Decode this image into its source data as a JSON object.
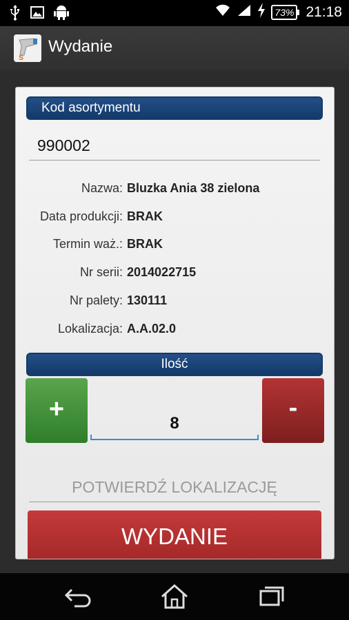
{
  "status_bar": {
    "battery": "73%",
    "time": "21:18",
    "icons": [
      "usb-icon",
      "image-icon",
      "android-icon",
      "wifi-icon",
      "signal-icon",
      "charging-icon",
      "battery-icon"
    ]
  },
  "action_bar": {
    "title": "Wydanie",
    "icon": "barcode-scanner-app-icon"
  },
  "form": {
    "kod_header": "Kod asortymentu",
    "kod_value": "990002",
    "details": [
      {
        "label": "Nazwa:",
        "value": "Bluzka Ania 38 zielona"
      },
      {
        "label": "Data produkcji:",
        "value": "BRAK"
      },
      {
        "label": "Termin waż.:",
        "value": "BRAK"
      },
      {
        "label": "Nr serii:",
        "value": "2014022715"
      },
      {
        "label": "Nr palety:",
        "value": "130111"
      },
      {
        "label": "Lokalizacja:",
        "value": "A.A.02.0"
      }
    ],
    "ilosc_header": "Ilość",
    "plus_label": "+",
    "minus_label": "-",
    "quantity": "8",
    "confirm_placeholder": "POTWIERDŹ LOKALIZACJĘ",
    "submit_label": "WYDANIE"
  },
  "colors": {
    "header_blue": "#1b4a80",
    "plus_green": "#3f8f35",
    "minus_red": "#9c2a2a",
    "submit_red": "#b83030",
    "quantity_underline": "#3a8bd6"
  },
  "nav_bar": {
    "icons": [
      "back-icon",
      "home-icon",
      "recent-apps-icon"
    ]
  }
}
